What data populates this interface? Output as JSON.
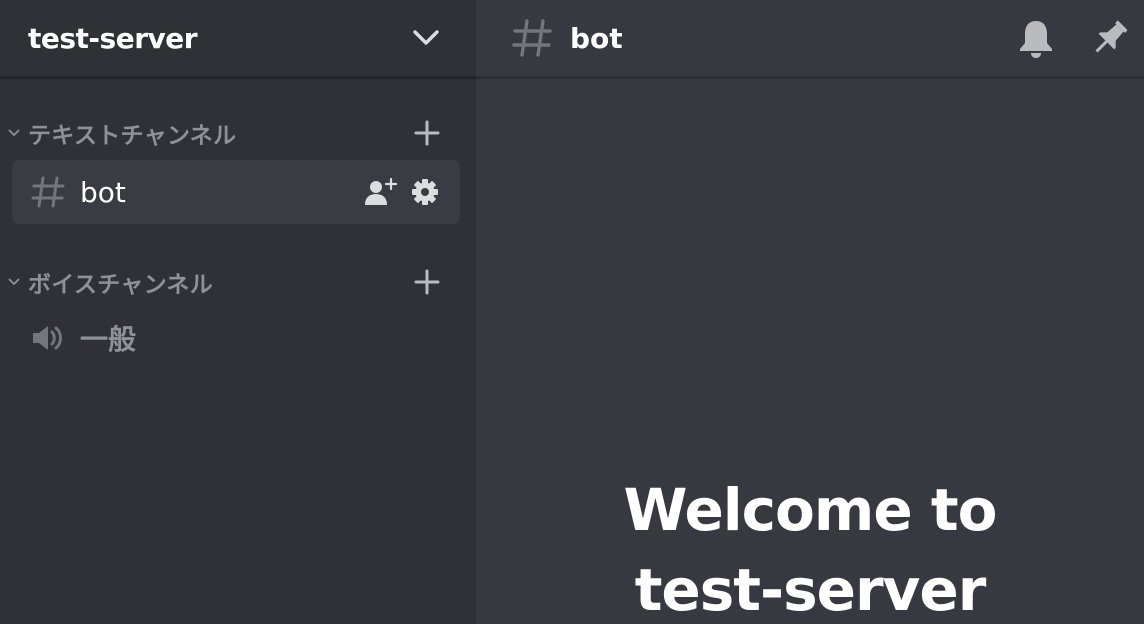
{
  "server": {
    "name": "test-server"
  },
  "sidebar": {
    "categories": [
      {
        "label": "テキストチャンネル",
        "channels": [
          {
            "name": "bot",
            "type": "text",
            "selected": true
          }
        ]
      },
      {
        "label": "ボイスチャンネル",
        "channels": [
          {
            "name": "一般",
            "type": "voice",
            "selected": false
          }
        ]
      }
    ]
  },
  "channel_header": {
    "title": "bot"
  },
  "welcome": {
    "line1": "Welcome to",
    "line2": "test-server"
  },
  "icons": {
    "server_menu": "chevron-down-icon",
    "category_collapse": "chevron-down-icon",
    "add_channel": "plus-icon",
    "text_channel": "hash-icon",
    "voice_channel": "speaker-icon",
    "invite": "add-user-icon",
    "settings": "gear-icon",
    "notifications": "bell-icon",
    "pinned": "pin-icon"
  },
  "colors": {
    "sidebar_bg": "#2f3136",
    "main_bg": "#36393f",
    "selected_channel_bg": "#393c43",
    "muted_text": "#8e9297",
    "icon_gray": "#b9bbbe",
    "white": "#ffffff"
  }
}
